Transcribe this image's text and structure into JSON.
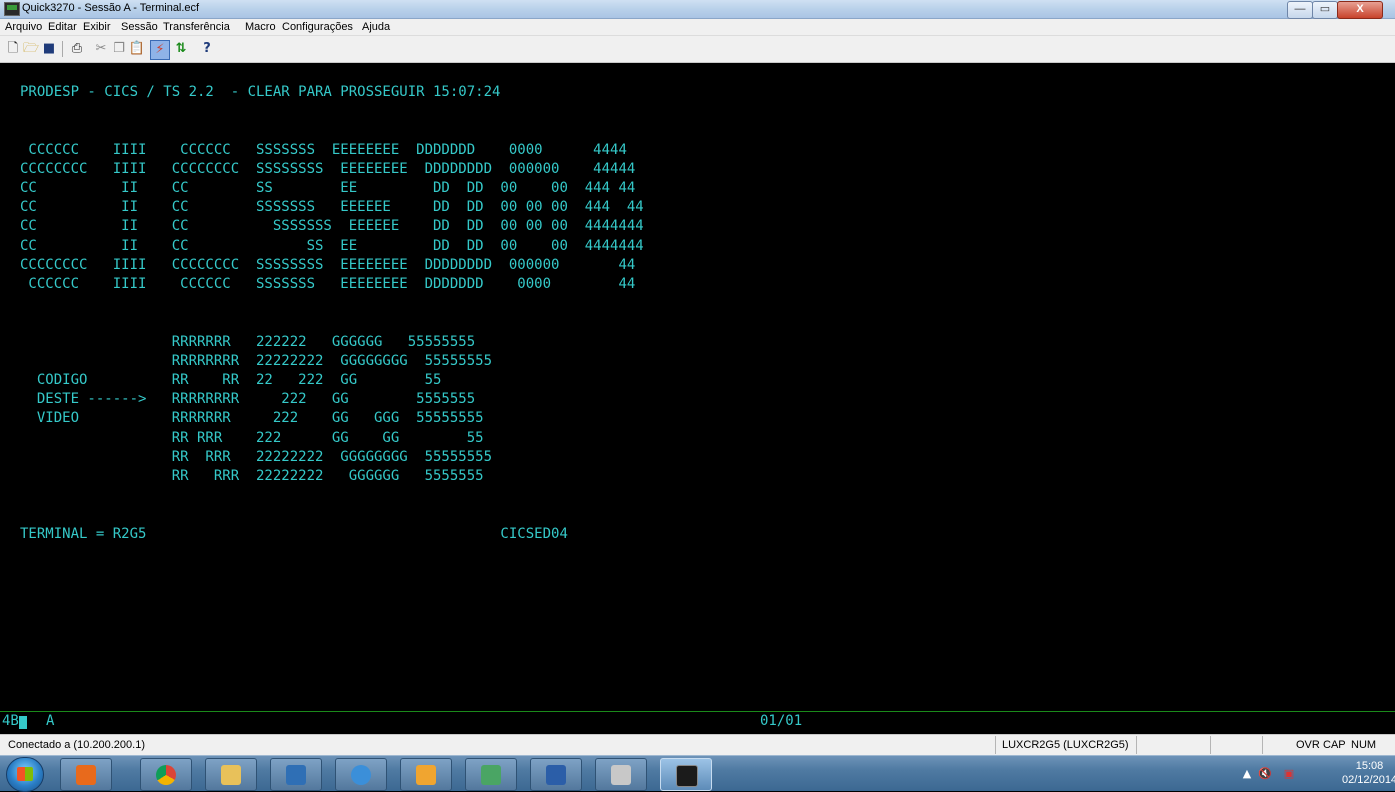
{
  "window": {
    "title": "Quick3270 - Sessão A - Terminal.ecf",
    "minimize_label": "—",
    "maximize_label": "▭",
    "close_label": "X"
  },
  "menu": [
    "Arquivo",
    "Editar",
    "Exibir",
    "Sessão",
    "Transferência",
    "Macro",
    "Configurações",
    "Ajuda"
  ],
  "toolbar_icons": [
    "new-file-icon",
    "open-folder-icon",
    "save-icon",
    "print-icon",
    "cut-icon",
    "copy-icon",
    "paste-icon",
    "connect-icon",
    "transfer-icon",
    "help-icon"
  ],
  "terminal": {
    "lines": [
      "PRODESP - CICS / TS 2.2  - CLEAR PARA PROSSEGUIR 15:07:24",
      "",
      "",
      " CCCCCC    IIII    CCCCCC   SSSSSSS  EEEEEEEE  DDDDDDD    0000      4444",
      "CCCCCCCC   IIII   CCCCCCCC  SSSSSSSS  EEEEEEEE  DDDDDDDD  000000    44444",
      "CC          II    CC        SS        EE         DD  DD  00    00  444 44",
      "CC          II    CC        SSSSSSS   EEEEEE     DD  DD  00 00 00  444  44",
      "CC          II    CC          SSSSSSS  EEEEEE    DD  DD  00 00 00  4444444",
      "CC          II    CC              SS  EE         DD  DD  00    00  4444444",
      "CCCCCCCC   IIII   CCCCCCCC  SSSSSSSS  EEEEEEEE  DDDDDDDD  000000       44",
      " CCCCCC    IIII    CCCCCC   SSSSSSS   EEEEEEEE  DDDDDDD    0000        44",
      "",
      "",
      "                  RRRRRRR   222222   GGGGGG   55555555",
      "                  RRRRRRRR  22222222  GGGGGGGG  55555555",
      "  CODIGO          RR    RR  22   222  GG        55",
      "  DESTE ------>   RRRRRRRR     222   GG        5555555",
      "  VIDEO           RRRRRRR     222    GG   GGG  55555555",
      "                  RR RRR    222      GG    GG        55",
      "                  RR  RRR   22222222  GGGGGGGG  55555555",
      "                  RR   RRR  22222222   GGGGGG   5555555",
      "",
      "",
      "TERMINAL = R2G5                                          CICSED04"
    ]
  },
  "oia": {
    "left": "4B",
    "mode": "A",
    "page": "01/01"
  },
  "status": {
    "connection": "Conectado a (10.200.200.1)",
    "lu": "LUXCR2G5 (LUXCR2G5)",
    "ovr": "OVR",
    "cap": "CAP",
    "num": "NUM"
  },
  "taskbar": {
    "apps": [
      "outlook-icon",
      "chrome-icon",
      "explorer-folder-icon",
      "task-manager-icon",
      "internet-explorer-icon",
      "outlook-mail-icon",
      "lync-people-icon",
      "word-icon",
      "printer-icon",
      "quick3270-icon"
    ],
    "active_app": "quick3270-icon",
    "time": "15:08",
    "date": "02/12/2014"
  },
  "colors": {
    "terminal_text": "#35c9c9",
    "terminal_bg": "#000000",
    "oia_rule": "#1a8a1a"
  }
}
